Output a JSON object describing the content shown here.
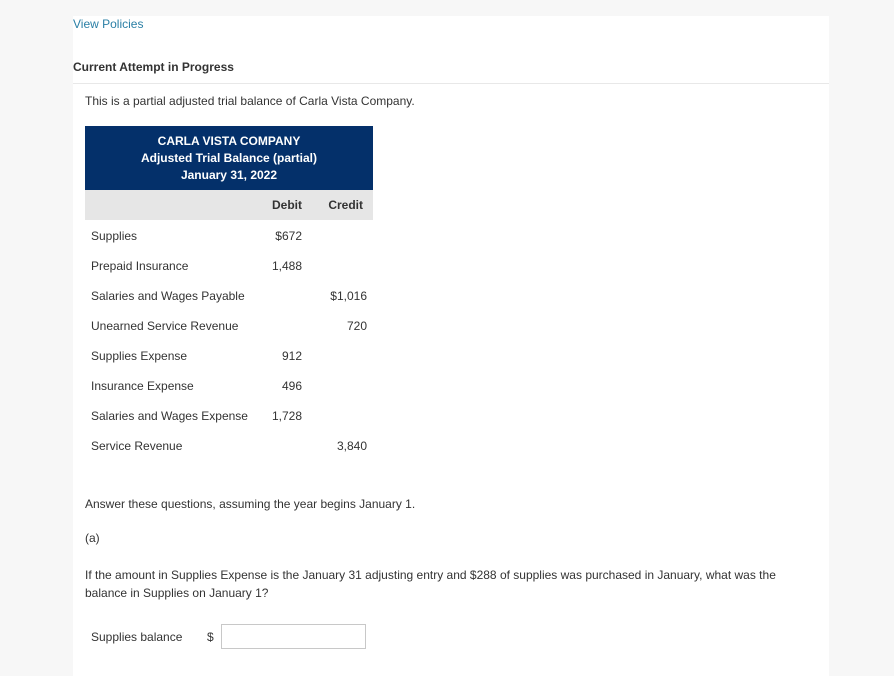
{
  "header": {
    "view_policies_link": "View Policies",
    "attempt_title": "Current Attempt in Progress"
  },
  "intro_text": "This is a partial adjusted trial balance of Carla Vista Company.",
  "trial_balance": {
    "company": "CARLA VISTA COMPANY",
    "statement": "Adjusted Trial Balance (partial)",
    "date": "January 31, 2022",
    "columns": {
      "debit": "Debit",
      "credit": "Credit"
    },
    "rows": [
      {
        "account": "Supplies",
        "debit": "$672",
        "credit": ""
      },
      {
        "account": "Prepaid Insurance",
        "debit": "1,488",
        "credit": ""
      },
      {
        "account": "Salaries and Wages Payable",
        "debit": "",
        "credit": "$1,016"
      },
      {
        "account": "Unearned Service Revenue",
        "debit": "",
        "credit": "720"
      },
      {
        "account": "Supplies Expense",
        "debit": "912",
        "credit": ""
      },
      {
        "account": "Insurance Expense",
        "debit": "496",
        "credit": ""
      },
      {
        "account": "Salaries and Wages Expense",
        "debit": "1,728",
        "credit": ""
      },
      {
        "account": "Service Revenue",
        "debit": "",
        "credit": "3,840"
      }
    ]
  },
  "question": {
    "intro": "Answer these questions, assuming the year begins January 1.",
    "part": "(a)",
    "text": "If the amount in Supplies Expense is the January 31 adjusting entry and $288 of supplies was purchased in January, what was the balance in Supplies on January 1?",
    "answer_label": "Supplies balance",
    "currency_symbol": "$",
    "answer_value": "",
    "answer_placeholder": ""
  }
}
